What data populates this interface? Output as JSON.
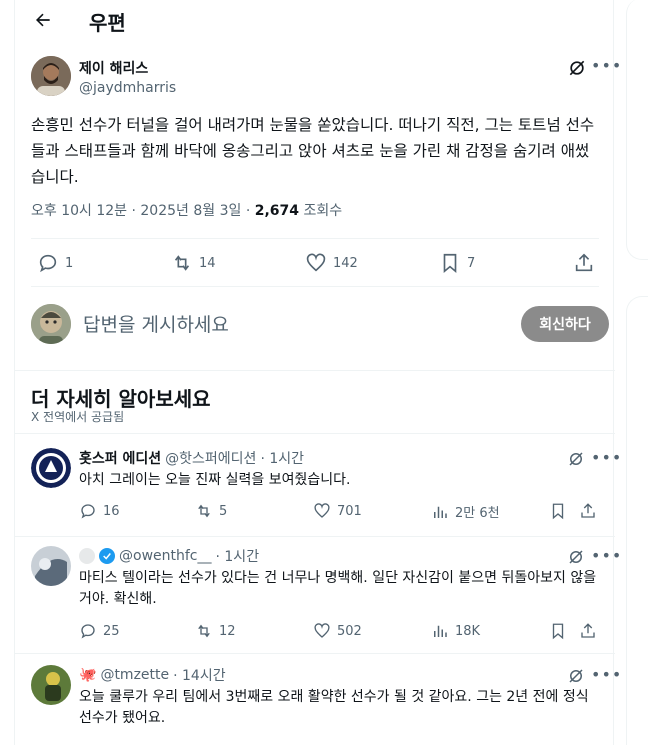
{
  "header": {
    "title": "우편"
  },
  "tweet": {
    "author_name": "제이 해리스",
    "author_handle": "@jaydmharris",
    "text": "손흥민 선수가 터널을 걸어 내려가며 눈물을 쏟았습니다. 떠나기 직전, 그는 토트넘 선수들과 스태프들과 함께 바닥에 옹송그리고 앉아 셔츠로 눈을 가린 채 감정을 숨기려 애썼습니다.",
    "time": "오후 10시 12분 · 2025년 8월 3일 · ",
    "views_count": "2,674",
    "views_label": " 조회수",
    "stats": {
      "replies": "1",
      "retweets": "14",
      "likes": "142",
      "bookmarks": "7"
    }
  },
  "reply_box": {
    "placeholder": "답변을 게시하세요",
    "button": "회신하다"
  },
  "more_section": {
    "title": "더 자세히 알아보세요",
    "subtitle": "X 전역에서 공급됨"
  },
  "recommendations": [
    {
      "name": "홋스퍼 에디션",
      "handle": "@핫스퍼에디션",
      "time": "· 1시간",
      "text": "아치 그레이는 오늘 진짜 실력을 보여줬습니다.",
      "replies": "16",
      "retweets": "5",
      "likes": "701",
      "views": "2만 6천"
    },
    {
      "name": "",
      "handle": "@owenthfc__",
      "time": "· 1시간",
      "text": "마티스 텔이라는 선수가 있다는 건 너무나 명백해. 일단 자신감이 붙으면 뒤돌아보지 않을 거야. 확신해.",
      "replies": "25",
      "retweets": "12",
      "likes": "502",
      "views": "18K"
    },
    {
      "name": "",
      "handle": "@tmzette",
      "time": "· 14시간",
      "text": "오늘 쿨루가 우리 팀에서 3번째로 오래 활약한 선수가 될 것 같아요. 그는 2년 전에 정식 선수가 됐어요."
    }
  ],
  "icons": {
    "back": "arrow-left-icon",
    "grok": "grok-icon",
    "more": "more-icon",
    "reply": "reply-icon",
    "retweet": "retweet-icon",
    "like": "heart-icon",
    "bookmark": "bookmark-icon",
    "share": "share-icon",
    "views": "views-icon"
  },
  "colors": {
    "text": "#0f1419",
    "secondary": "#536471",
    "verified": "#1d9bf0",
    "reply_button": "#8b8b8b"
  }
}
